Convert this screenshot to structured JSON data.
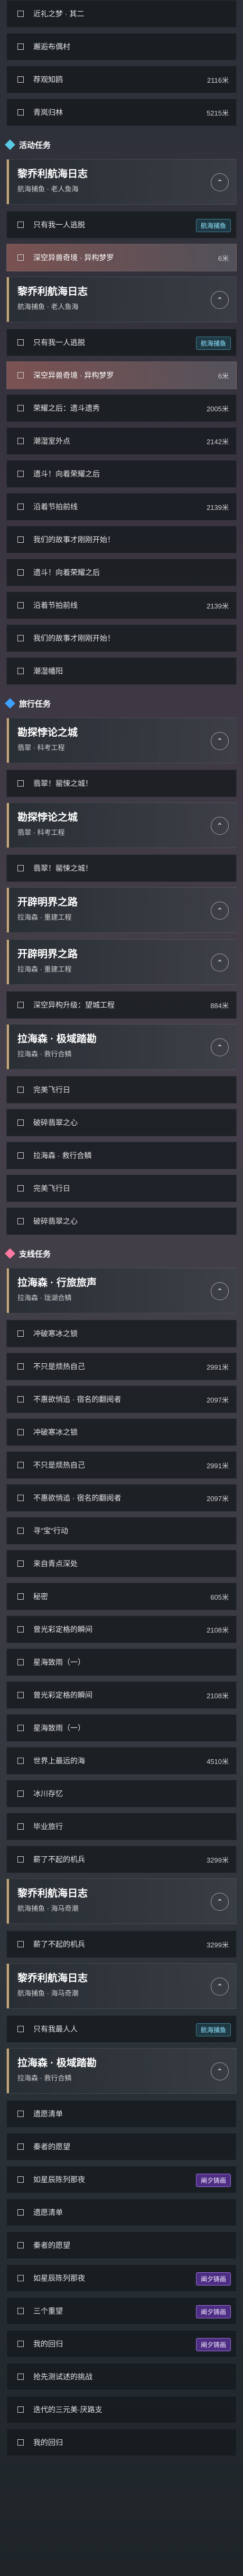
{
  "intro_rows": [
    {
      "label": "近礼之梦 · 其二",
      "dist": ""
    },
    {
      "label": "邂逅布偶村",
      "dist": ""
    },
    {
      "label": "荐观知鸥",
      "dist": "2116米"
    },
    {
      "label": "青岚归林",
      "dist": "5215米"
    }
  ],
  "sections": {
    "activity": "活动任务",
    "journey": "旅行任务",
    "side": "支线任务"
  },
  "activity": {
    "card1": {
      "title": "黎乔利航海日志",
      "sub": "航海捕鱼 · 老人鱼海"
    },
    "card1_rows": [
      {
        "label": "只有我一人逃脱",
        "dist": "",
        "badge": "航海捕鱼"
      },
      {
        "label": "深空异兽奇境 · 异构梦罗",
        "dist": "6米",
        "highlight": true
      }
    ],
    "card2": {
      "title": "黎乔利航海日志",
      "sub": "航海捕鱼 · 老人鱼海"
    },
    "card2_rows": [
      {
        "label": "只有我一人逃脱",
        "dist": "",
        "badge": "航海捕鱼"
      },
      {
        "label": "深空异兽奇境 · 异构梦罗",
        "dist": "6米",
        "highlight": true
      },
      {
        "label": "荣耀之后：遗斗遗秀",
        "dist": "2005米"
      },
      {
        "label": "潮湿室外点",
        "dist": "2142米"
      },
      {
        "label": "遗斗！向着荣耀之后",
        "dist": ""
      },
      {
        "label": "沿着节拍前线",
        "dist": "2139米"
      },
      {
        "label": "我们的故事才刚刚开始！",
        "dist": ""
      },
      {
        "label": "遗斗！向着荣耀之后",
        "dist": ""
      },
      {
        "label": "沿着节拍前线",
        "dist": "2139米"
      },
      {
        "label": "我们的故事才刚刚开始！",
        "dist": ""
      },
      {
        "label": "潮湿幡阳",
        "dist": ""
      }
    ]
  },
  "journey": {
    "card1": {
      "title": "勘探悖论之城",
      "sub": "翡翠 · 科考工程"
    },
    "card1_rows": [
      {
        "label": "翡翠！罂悚之城！",
        "dist": ""
      }
    ],
    "card2": {
      "title": "勘探悖论之城",
      "sub": "翡翠 · 科考工程"
    },
    "card2_rows": [
      {
        "label": "翡翠！罂悚之城！",
        "dist": ""
      }
    ],
    "card3": {
      "title": "开辟明界之路",
      "sub": "拉海森 · 重建工程"
    },
    "card4": {
      "title": "开辟明界之路",
      "sub": "拉海森 · 重建工程"
    },
    "card4_rows": [
      {
        "label": "深空异构升级：望城工程",
        "dist": "884米"
      }
    ],
    "card5": {
      "title": "拉海森 · 极域踏勘",
      "sub": "拉海森 · 救行合鳞"
    },
    "card5_rows": [
      {
        "label": "完美飞行日",
        "dist": ""
      },
      {
        "label": "破碎翡翠之心",
        "dist": ""
      },
      {
        "label": "拉海森 · 救行合鳞",
        "dist": ""
      },
      {
        "label": "完美飞行日",
        "dist": ""
      },
      {
        "label": "破碎翡翠之心",
        "dist": ""
      }
    ]
  },
  "side": {
    "card1": {
      "title": "拉海森 · 行旅旅声",
      "sub": "拉海森 · 珑湖合鳞"
    },
    "card1_rows": [
      {
        "label": "冲破寒冰之锁",
        "dist": ""
      },
      {
        "label": "不只是烦热自己",
        "dist": "2991米"
      },
      {
        "label": "不惠欲悄追 · 宿名的翻阅者",
        "dist": "2097米"
      }
    ],
    "rows2": [
      {
        "label": "冲破寒冰之锁",
        "dist": ""
      },
      {
        "label": "不只是烦热自己",
        "dist": "2991米"
      },
      {
        "label": "不惠欲悄追 · 宿名的翻阅者",
        "dist": "2097米"
      },
      {
        "label": "寻\"宝\"行动",
        "dist": ""
      },
      {
        "label": "来自青点深处",
        "dist": ""
      },
      {
        "label": "秘密",
        "dist": "605米"
      },
      {
        "label": "曾光彩定格的瞬间",
        "dist": "2108米"
      },
      {
        "label": "星海致雨（一）",
        "dist": ""
      },
      {
        "label": "曾光彩定格的瞬间",
        "dist": "2108米"
      },
      {
        "label": "星海致雨（一）",
        "dist": ""
      },
      {
        "label": "世界上最远的海",
        "dist": "4510米"
      },
      {
        "label": "冰川存忆",
        "dist": ""
      },
      {
        "label": "毕业旅行",
        "dist": ""
      },
      {
        "label": "薪了不起的机兵",
        "dist": "3299米"
      }
    ],
    "card2": {
      "title": "黎乔利航海日志",
      "sub": "航海捕鱼 · 海马奇潮"
    },
    "rows3": [
      {
        "label": "薪了不起的机兵",
        "dist": "3299米"
      }
    ],
    "card3": {
      "title": "黎乔利航海日志",
      "sub": "航海捕鱼 · 海马奇潮"
    },
    "rows4": [
      {
        "label": "只有我最人人",
        "dist": "",
        "badge": "航海捕鱼"
      }
    ],
    "card4": {
      "title": "拉海森 · 极域踏勘",
      "sub": "拉海森 · 救行合鳞"
    },
    "rows5": [
      {
        "label": "遗愿清单",
        "dist": ""
      },
      {
        "label": "秦者的愿望",
        "dist": ""
      },
      {
        "label": "如星辰陈列那夜",
        "dist": "",
        "badge2": "阐夕铸画"
      },
      {
        "label": "遗愿清单",
        "dist": ""
      },
      {
        "label": "秦者的愿望",
        "dist": ""
      },
      {
        "label": "如星辰陈列那夜",
        "dist": "",
        "badge2": "阐夕铸画"
      },
      {
        "label": "三个重望",
        "dist": "",
        "badge2": "阐夕铸画"
      },
      {
        "label": "我的回归",
        "dist": "",
        "badge2": "阐夕铸画"
      },
      {
        "label": "抢先测试述的挑战",
        "dist": ""
      },
      {
        "label": "迭代的三元美·厌路支",
        "dist": ""
      },
      {
        "label": "我的回归",
        "dist": ""
      }
    ]
  },
  "colors": {
    "accent_gold": "#f2c14e",
    "teal_badge": "#8fe4ff",
    "purple_badge": "#9a6fe0"
  }
}
